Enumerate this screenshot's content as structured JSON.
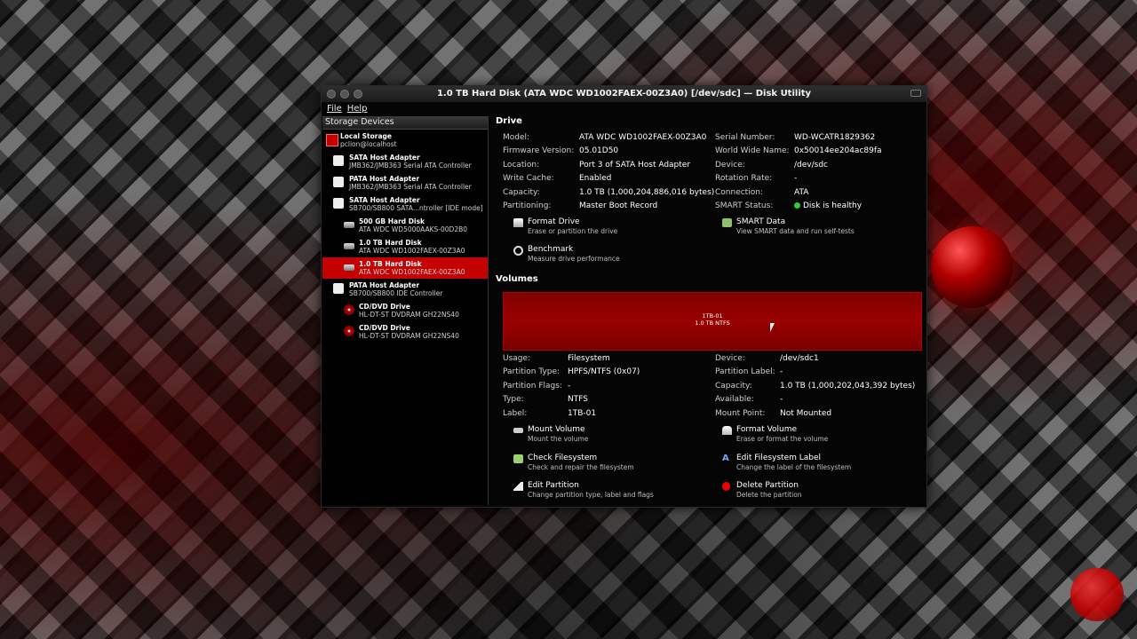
{
  "window": {
    "title": "1.0 TB Hard Disk (ATA WDC WD1002FAEX-00Z3A0) [/dev/sdc] — Disk Utility",
    "menu": [
      "File",
      "Help"
    ]
  },
  "sidebar": {
    "header": "Storage Devices",
    "items": [
      {
        "title": "Local Storage",
        "subtitle": "pclion@localhost",
        "icon": "local-storage-icon",
        "level": 0
      },
      {
        "title": "SATA Host Adapter",
        "subtitle": "JMB362/JMB363 Serial ATA Controller",
        "icon": "adapter-icon",
        "level": 1
      },
      {
        "title": "PATA Host Adapter",
        "subtitle": "JMB362/JMB363 Serial ATA Controller",
        "icon": "adapter-icon",
        "level": 1
      },
      {
        "title": "SATA Host Adapter",
        "subtitle": "SB700/SB800 SATA...ntroller [IDE mode]",
        "icon": "adapter-icon",
        "level": 1
      },
      {
        "title": "500 GB Hard Disk",
        "subtitle": "ATA WDC WD5000AAKS-00D2B0",
        "icon": "hard-disk-icon",
        "level": 2
      },
      {
        "title": "1.0 TB Hard Disk",
        "subtitle": "ATA WDC WD1002FAEX-00Z3A0",
        "icon": "hard-disk-icon",
        "level": 2
      },
      {
        "title": "1.0 TB Hard Disk",
        "subtitle": "ATA WDC WD1002FAEX-00Z3A0",
        "icon": "hard-disk-icon",
        "level": 2,
        "selected": true
      },
      {
        "title": "PATA Host Adapter",
        "subtitle": "SB700/SB800 IDE Controller",
        "icon": "adapter-icon",
        "level": 1
      },
      {
        "title": "CD/DVD Drive",
        "subtitle": "HL-DT-ST DVDRAM GH22NS40",
        "icon": "cd-drive-icon",
        "level": 2
      },
      {
        "title": "CD/DVD Drive",
        "subtitle": "HL-DT-ST DVDRAM GH22NS40",
        "icon": "cd-drive-icon",
        "level": 2
      }
    ]
  },
  "drive": {
    "section_title": "Drive",
    "left": [
      {
        "k": "Model:",
        "v": "ATA WDC WD1002FAEX-00Z3A0"
      },
      {
        "k": "Firmware Version:",
        "v": "05.01D50"
      },
      {
        "k": "Location:",
        "v": "Port 3 of SATA Host Adapter"
      },
      {
        "k": "Write Cache:",
        "v": "Enabled"
      },
      {
        "k": "Capacity:",
        "v": "1.0 TB (1,000,204,886,016 bytes)"
      },
      {
        "k": "Partitioning:",
        "v": "Master Boot Record"
      }
    ],
    "right": [
      {
        "k": "Serial Number:",
        "v": "WD-WCATR1829362"
      },
      {
        "k": "World Wide Name:",
        "v": "0x50014ee204ac89fa"
      },
      {
        "k": "Device:",
        "v": "/dev/sdc"
      },
      {
        "k": "Rotation Rate:",
        "v": "-"
      },
      {
        "k": "Connection:",
        "v": "ATA"
      },
      {
        "k": "SMART Status:",
        "v": "Disk is healthy"
      }
    ],
    "actions": {
      "format_label": "Format Drive",
      "format_sub": "Erase or partition the drive",
      "smart_label": "SMART Data",
      "smart_sub": "View SMART data and run self-tests",
      "benchmark_label": "Benchmark",
      "benchmark_sub": "Measure drive performance"
    }
  },
  "volumes": {
    "section_title": "Volumes",
    "bar_name": "1TB-01",
    "bar_size": "1.0 TB NTFS",
    "left": [
      {
        "k": "Usage:",
        "v": "Filesystem"
      },
      {
        "k": "Partition Type:",
        "v": "HPFS/NTFS (0x07)"
      },
      {
        "k": "Partition Flags:",
        "v": "-"
      },
      {
        "k": "Type:",
        "v": "NTFS"
      },
      {
        "k": "Label:",
        "v": "1TB-01"
      }
    ],
    "right": [
      {
        "k": "Device:",
        "v": "/dev/sdc1"
      },
      {
        "k": "Partition Label:",
        "v": "-"
      },
      {
        "k": "Capacity:",
        "v": "1.0 TB (1,000,202,043,392 bytes)"
      },
      {
        "k": "Available:",
        "v": "-"
      },
      {
        "k": "Mount Point:",
        "v": "Not Mounted"
      }
    ],
    "actions": {
      "mount_label": "Mount Volume",
      "mount_sub": "Mount the volume",
      "format_label": "Format Volume",
      "format_sub": "Erase or format the volume",
      "check_label": "Check Filesystem",
      "check_sub": "Check and repair the filesystem",
      "editlabel_label": "Edit Filesystem Label",
      "editlabel_sub": "Change the label of the filesystem",
      "editpart_label": "Edit Partition",
      "editpart_sub": "Change partition type, label and flags",
      "delete_label": "Delete Partition",
      "delete_sub": "Delete the partition"
    }
  },
  "colors": {
    "accent": "#c40000",
    "healthy": "#2ecc40"
  }
}
